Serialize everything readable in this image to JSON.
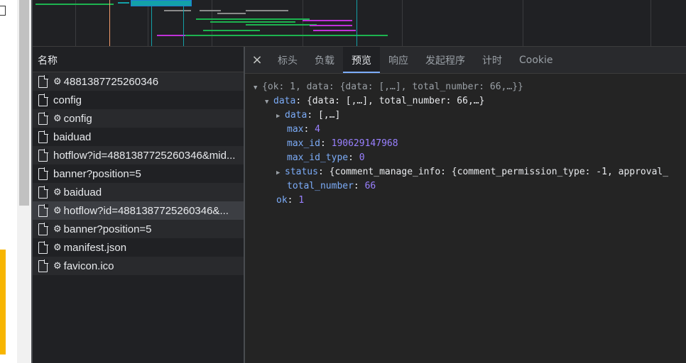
{
  "name_panel": {
    "header": "名称",
    "rows": [
      {
        "label": "4881387725260346",
        "gear": true
      },
      {
        "label": "config",
        "gear": false
      },
      {
        "label": "config",
        "gear": true
      },
      {
        "label": "baiduad",
        "gear": false
      },
      {
        "label": "hotflow?id=4881387725260346&mid...",
        "gear": false
      },
      {
        "label": "banner?position=5",
        "gear": false
      },
      {
        "label": "baiduad",
        "gear": true
      },
      {
        "label": "hotflow?id=4881387725260346&...",
        "gear": true,
        "selected": true
      },
      {
        "label": "banner?position=5",
        "gear": true
      },
      {
        "label": "manifest.json",
        "gear": true
      },
      {
        "label": "favicon.ico",
        "gear": true
      }
    ]
  },
  "tabs": {
    "close": "×",
    "items": [
      "标头",
      "负载",
      "预览",
      "响应",
      "发起程序",
      "计时",
      "Cookie"
    ],
    "active": "预览"
  },
  "preview": {
    "root_summary": "{ok: 1, data: {data: [,…], total_number: 66,…}}",
    "data_key": "data",
    "data_summary": "{data: [,…], total_number: 66,…}",
    "inner_data_key": "data",
    "inner_data_value": "[,…]",
    "max_key": "max",
    "max_value": "4",
    "max_id_key": "max_id",
    "max_id_value": "190629147968",
    "max_id_type_key": "max_id_type",
    "max_id_type_value": "0",
    "status_key": "status",
    "status_value": "{comment_manage_info: {comment_permission_type: -1, approval_",
    "total_number_key": "total_number",
    "total_number_value": "66",
    "ok_key": "ok",
    "ok_value": "1"
  },
  "colors": {
    "accent": "#7cacf8",
    "number": "#9980ff",
    "bar_green": "#1db34f",
    "bar_magenta": "#c031d8",
    "bar_teal": "#13a1a8",
    "bar_orange": "#f29b6a",
    "bar_gray": "#8a8a8a"
  }
}
